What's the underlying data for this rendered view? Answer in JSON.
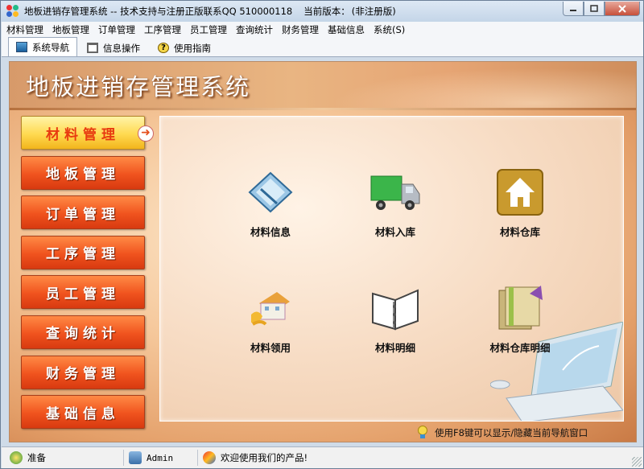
{
  "window": {
    "app_title": "地板进销存管理系统 -- 技术支持与注册正版联系QQ 510000118",
    "version_label": "当前版本：",
    "version_value": "(非注册版)"
  },
  "menubar": {
    "items": [
      {
        "label": "材料管理"
      },
      {
        "label": "地板管理"
      },
      {
        "label": "订单管理"
      },
      {
        "label": "工序管理"
      },
      {
        "label": "员工管理"
      },
      {
        "label": "查询统计"
      },
      {
        "label": "财务管理"
      },
      {
        "label": "基础信息"
      },
      {
        "label": "系统(S)"
      }
    ]
  },
  "tabs": [
    {
      "label": "系统导航",
      "icon": "nav-icon"
    },
    {
      "label": "信息操作",
      "icon": "info-icon"
    },
    {
      "label": "使用指南",
      "icon": "help-icon"
    }
  ],
  "banner": {
    "title": "地板进销存管理系统"
  },
  "nav": {
    "items": [
      {
        "label": "材料管理",
        "active": true
      },
      {
        "label": "地板管理"
      },
      {
        "label": "订单管理"
      },
      {
        "label": "工序管理"
      },
      {
        "label": "员工管理"
      },
      {
        "label": "查询统计"
      },
      {
        "label": "财务管理"
      },
      {
        "label": "基础信息"
      }
    ]
  },
  "tiles": [
    {
      "label": "材料信息",
      "icon": "material-info-icon"
    },
    {
      "label": "材料入库",
      "icon": "truck-icon"
    },
    {
      "label": "材料仓库",
      "icon": "warehouse-icon"
    },
    {
      "label": "材料领用",
      "icon": "material-use-icon"
    },
    {
      "label": "材料明细",
      "icon": "binder-icon"
    },
    {
      "label": "材料仓库明细",
      "icon": "ledger-icon"
    }
  ],
  "hint": {
    "text": "使用F8键可以显示/隐藏当前导航窗口"
  },
  "status": {
    "ready": "准备",
    "user": "Admin",
    "welcome": "欢迎使用我们的产品!"
  }
}
